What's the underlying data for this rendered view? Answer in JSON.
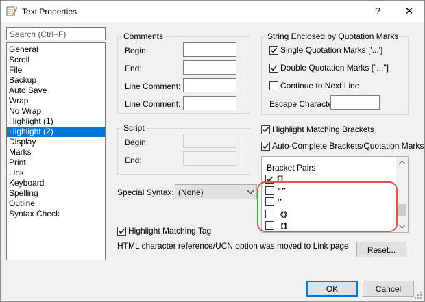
{
  "window": {
    "title": "Text Properties",
    "help_label": "?",
    "close_label": "✕"
  },
  "search": {
    "placeholder": "Search (Ctrl+F)"
  },
  "nav": {
    "items": [
      "General",
      "Scroll",
      "File",
      "Backup",
      "Auto Save",
      "Wrap",
      "No Wrap",
      "Highlight (1)",
      "Highlight (2)",
      "Display",
      "Marks",
      "Print",
      "Link",
      "Keyboard",
      "Spelling",
      "Outline",
      "Syntax Check"
    ],
    "selected": "Highlight (2)"
  },
  "comments": {
    "title": "Comments",
    "begin": "Begin:",
    "end": "End:",
    "line_comment_1": "Line Comment:",
    "line_comment_2": "Line Comment:"
  },
  "script": {
    "title": "Script",
    "begin": "Begin:",
    "end": "End:"
  },
  "quotes": {
    "title": "String Enclosed by Quotation Marks",
    "single": "Single Quotation Marks ['...']",
    "single_checked": true,
    "double": "Double Quotation Marks [\"...\"]",
    "double_checked": true,
    "continue": "Continue to Next Line",
    "continue_checked": false,
    "escape": "Escape Character:"
  },
  "brackets": {
    "highlight_matching": "Highlight Matching Brackets",
    "highlight_matching_checked": true,
    "auto_complete": "Auto-Complete Brackets/Quotation Marks",
    "auto_complete_checked": true,
    "pairs_header": "Bracket Pairs",
    "pairs": [
      {
        "text": "[]",
        "checked": true
      },
      {
        "text": "“”",
        "checked": false
      },
      {
        "text": "‘’",
        "checked": false
      },
      {
        "text": "《》",
        "checked": false
      },
      {
        "text": "【】",
        "checked": false
      }
    ]
  },
  "special_syntax": {
    "label": "Special Syntax:",
    "value": "(None)"
  },
  "highlight_tag": {
    "label": "Highlight Matching Tag",
    "checked": true
  },
  "note": "HTML character reference/UCN option was moved to Link page",
  "buttons": {
    "reset": "Reset...",
    "ok": "OK",
    "cancel": "Cancel"
  },
  "colors": {
    "accent": "#0078d7",
    "annotation": "#d9534f"
  },
  "icons": {
    "app": "text-properties-icon",
    "check": "checkmark-icon",
    "dropdown": "chevron-down-icon"
  }
}
